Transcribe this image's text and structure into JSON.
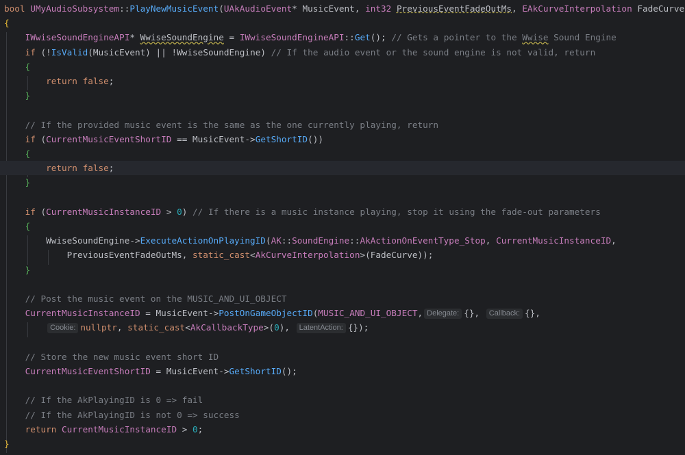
{
  "editor": {
    "language": "C++",
    "theme_colors": {
      "background": "#1e1f22",
      "current_line": "#26282e",
      "keyword": "#cf8e6d",
      "function": "#57aaf7",
      "type_or_member": "#c77dbb",
      "comment": "#7a7e85",
      "number": "#2aacb8",
      "default_text": "#bcbec4",
      "brace": "#e8ba36",
      "inlay_hint_background": "#2b2d30",
      "inlay_hint_text": "#868a91"
    },
    "lines": [
      {
        "tokens": [
          {
            "t": "bool ",
            "c": "kw"
          },
          {
            "t": "UMyAudioSubsystem",
            "c": "ty"
          },
          {
            "t": "::",
            "c": "op"
          },
          {
            "t": "PlayNewMusicEvent",
            "c": "fn"
          },
          {
            "t": "(",
            "c": "tx"
          },
          {
            "t": "UAkAudioEvent",
            "c": "ty"
          },
          {
            "t": "* ",
            "c": "tx"
          },
          {
            "t": "MusicEvent",
            "c": "tx"
          },
          {
            "t": ", ",
            "c": "tx"
          },
          {
            "t": "int32 ",
            "c": "ty"
          },
          {
            "t": "PreviousEventFadeOutMs",
            "c": "tx",
            "u": "dot"
          },
          {
            "t": ", ",
            "c": "tx"
          },
          {
            "t": "EAkCurveInterpolation ",
            "c": "ty"
          },
          {
            "t": "FadeCurve",
            "c": "tx"
          },
          {
            "t": ")",
            "c": "tx"
          }
        ]
      },
      {
        "tokens": [
          {
            "t": "{",
            "c": "br"
          }
        ]
      },
      {
        "tokens": [
          {
            "t": "    "
          },
          {
            "t": "IWwiseSoundEngineAPI",
            "c": "ty"
          },
          {
            "t": "* ",
            "c": "tx"
          },
          {
            "t": "WwiseSoundEngine",
            "c": "tx",
            "u": "ul"
          },
          {
            "t": " = ",
            "c": "tx"
          },
          {
            "t": "IWwiseSoundEngineAPI",
            "c": "ty"
          },
          {
            "t": "::",
            "c": "op"
          },
          {
            "t": "Get",
            "c": "fn"
          },
          {
            "t": "(); ",
            "c": "tx"
          },
          {
            "t": "// Gets a pointer to the ",
            "c": "cm"
          },
          {
            "t": "Wwise",
            "c": "cm",
            "u": "ul"
          },
          {
            "t": " Sound Engine",
            "c": "cm"
          }
        ]
      },
      {
        "tokens": [
          {
            "t": "    "
          },
          {
            "t": "if ",
            "c": "kw"
          },
          {
            "t": "(!",
            "c": "tx"
          },
          {
            "t": "IsValid",
            "c": "fn"
          },
          {
            "t": "(",
            "c": "tx"
          },
          {
            "t": "MusicEvent",
            "c": "tx"
          },
          {
            "t": ") || !",
            "c": "tx"
          },
          {
            "t": "WwiseSoundEngine",
            "c": "tx"
          },
          {
            "t": ") ",
            "c": "tx"
          },
          {
            "t": "// If the audio event or the sound engine is not valid, return",
            "c": "cm"
          }
        ]
      },
      {
        "tokens": [
          {
            "t": "    "
          },
          {
            "t": "{",
            "c": "br2"
          }
        ]
      },
      {
        "tokens": [
          {
            "t": "        "
          },
          {
            "t": "return ",
            "c": "kw"
          },
          {
            "t": "false",
            "c": "kw"
          },
          {
            "t": ";",
            "c": "tx"
          }
        ]
      },
      {
        "tokens": [
          {
            "t": "    "
          },
          {
            "t": "}",
            "c": "br2"
          }
        ]
      },
      {
        "tokens": []
      },
      {
        "tokens": [
          {
            "t": "    "
          },
          {
            "t": "// If the provided music event is the same as the one currently playing, return",
            "c": "cm"
          }
        ]
      },
      {
        "tokens": [
          {
            "t": "    "
          },
          {
            "t": "if ",
            "c": "kw"
          },
          {
            "t": "(",
            "c": "tx"
          },
          {
            "t": "CurrentMusicEventShortID",
            "c": "vr"
          },
          {
            "t": " == ",
            "c": "tx"
          },
          {
            "t": "MusicEvent",
            "c": "tx"
          },
          {
            "t": "->",
            "c": "tx"
          },
          {
            "t": "GetShortID",
            "c": "fn"
          },
          {
            "t": "())",
            "c": "tx"
          }
        ]
      },
      {
        "tokens": [
          {
            "t": "    "
          },
          {
            "t": "{",
            "c": "br2"
          }
        ]
      },
      {
        "tokens": [
          {
            "t": "        "
          },
          {
            "t": "return ",
            "c": "kw"
          },
          {
            "t": "false",
            "c": "kw"
          },
          {
            "t": ";",
            "c": "tx"
          }
        ],
        "current": true
      },
      {
        "tokens": [
          {
            "t": "    "
          },
          {
            "t": "}",
            "c": "br2"
          }
        ]
      },
      {
        "tokens": []
      },
      {
        "tokens": [
          {
            "t": "    "
          },
          {
            "t": "if ",
            "c": "kw"
          },
          {
            "t": "(",
            "c": "tx"
          },
          {
            "t": "CurrentMusicInstanceID",
            "c": "vr"
          },
          {
            "t": " > ",
            "c": "tx"
          },
          {
            "t": "0",
            "c": "nm"
          },
          {
            "t": ") ",
            "c": "tx"
          },
          {
            "t": "// If there is a music instance playing, stop it using the fade-out parameters",
            "c": "cm"
          }
        ]
      },
      {
        "tokens": [
          {
            "t": "    "
          },
          {
            "t": "{",
            "c": "br2"
          }
        ]
      },
      {
        "tokens": [
          {
            "t": "        "
          },
          {
            "t": "WwiseSoundEngine",
            "c": "tx"
          },
          {
            "t": "->",
            "c": "tx"
          },
          {
            "t": "ExecuteActionOnPlayingID",
            "c": "fn"
          },
          {
            "t": "(",
            "c": "tx"
          },
          {
            "t": "AK",
            "c": "ty"
          },
          {
            "t": "::",
            "c": "op"
          },
          {
            "t": "SoundEngine",
            "c": "ty"
          },
          {
            "t": "::",
            "c": "op"
          },
          {
            "t": "AkActionOnEventType_Stop",
            "c": "vr"
          },
          {
            "t": ", ",
            "c": "tx"
          },
          {
            "t": "CurrentMusicInstanceID",
            "c": "vr"
          },
          {
            "t": ",",
            "c": "tx"
          }
        ]
      },
      {
        "tokens": [
          {
            "t": "            "
          },
          {
            "t": "PreviousEventFadeOutMs",
            "c": "tx"
          },
          {
            "t": ", ",
            "c": "tx"
          },
          {
            "t": "static_cast",
            "c": "kw"
          },
          {
            "t": "<",
            "c": "tx"
          },
          {
            "t": "AkCurveInterpolation",
            "c": "ty"
          },
          {
            "t": ">(",
            "c": "tx"
          },
          {
            "t": "FadeCurve",
            "c": "tx"
          },
          {
            "t": "));",
            "c": "tx"
          }
        ]
      },
      {
        "tokens": [
          {
            "t": "    "
          },
          {
            "t": "}",
            "c": "br2"
          }
        ]
      },
      {
        "tokens": []
      },
      {
        "tokens": [
          {
            "t": "    "
          },
          {
            "t": "// Post the music event on the MUSIC_AND_UI_OBJECT",
            "c": "cm"
          }
        ]
      },
      {
        "tokens": [
          {
            "t": "    "
          },
          {
            "t": "CurrentMusicInstanceID",
            "c": "vr"
          },
          {
            "t": " = ",
            "c": "tx"
          },
          {
            "t": "MusicEvent",
            "c": "tx"
          },
          {
            "t": "->",
            "c": "tx"
          },
          {
            "t": "PostOnGameObjectID",
            "c": "fn"
          },
          {
            "t": "(",
            "c": "tx"
          },
          {
            "t": "MUSIC_AND_UI_OBJECT",
            "c": "vr"
          },
          {
            "t": ",",
            "c": "tx"
          },
          {
            "h": "Delegate:"
          },
          {
            "t": "{}",
            "c": "tx"
          },
          {
            "t": ", ",
            "c": "tx"
          },
          {
            "h": "Callback:"
          },
          {
            "t": "{}",
            "c": "tx"
          },
          {
            "t": ",",
            "c": "tx"
          }
        ]
      },
      {
        "tokens": [
          {
            "t": "        "
          },
          {
            "h": "Cookie:"
          },
          {
            "t": "nullptr",
            "c": "kw"
          },
          {
            "t": ", ",
            "c": "tx"
          },
          {
            "t": "static_cast",
            "c": "kw"
          },
          {
            "t": "<",
            "c": "tx"
          },
          {
            "t": "AkCallbackType",
            "c": "ty"
          },
          {
            "t": ">(",
            "c": "tx"
          },
          {
            "t": "0",
            "c": "nm"
          },
          {
            "t": "), ",
            "c": "tx"
          },
          {
            "h": "LatentAction:"
          },
          {
            "t": "{}",
            "c": "tx"
          },
          {
            "t": ");",
            "c": "tx"
          }
        ]
      },
      {
        "tokens": []
      },
      {
        "tokens": [
          {
            "t": "    "
          },
          {
            "t": "// Store the new music event short ID",
            "c": "cm"
          }
        ]
      },
      {
        "tokens": [
          {
            "t": "    "
          },
          {
            "t": "CurrentMusicEventShortID",
            "c": "vr"
          },
          {
            "t": " = ",
            "c": "tx"
          },
          {
            "t": "MusicEvent",
            "c": "tx"
          },
          {
            "t": "->",
            "c": "tx"
          },
          {
            "t": "GetShortID",
            "c": "fn"
          },
          {
            "t": "();",
            "c": "tx"
          }
        ]
      },
      {
        "tokens": []
      },
      {
        "tokens": [
          {
            "t": "    "
          },
          {
            "t": "// If the AkPlayingID is 0 => fail",
            "c": "cm"
          }
        ]
      },
      {
        "tokens": [
          {
            "t": "    "
          },
          {
            "t": "// If the AkPlayingID is not 0 => success",
            "c": "cm"
          }
        ]
      },
      {
        "tokens": [
          {
            "t": "    "
          },
          {
            "t": "return ",
            "c": "kw"
          },
          {
            "t": "CurrentMusicInstanceID",
            "c": "vr"
          },
          {
            "t": " > ",
            "c": "tx"
          },
          {
            "t": "0",
            "c": "nm"
          },
          {
            "t": ";",
            "c": "tx"
          }
        ]
      },
      {
        "tokens": [
          {
            "t": "}",
            "c": "br"
          }
        ]
      }
    ]
  }
}
